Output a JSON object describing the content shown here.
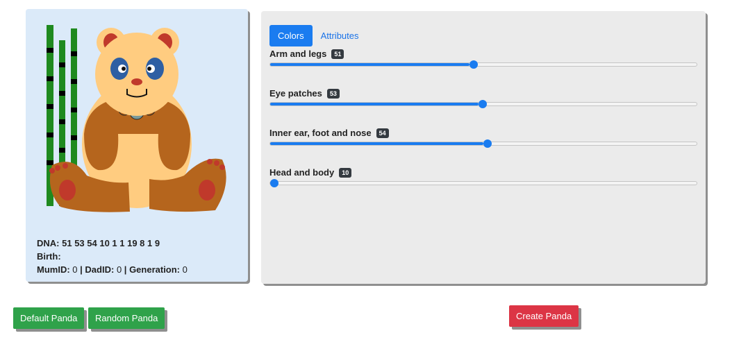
{
  "colors": {
    "accent": "#1a7cf0",
    "card_bg": "#dbeaf9",
    "panel_bg": "#ebebeb",
    "green_button": "#2fa24a",
    "red_button": "#dc3545",
    "panda_body": "#ffcc80",
    "panda_limbs": "#b5651d",
    "panda_eye_patch": "#2e5fa3",
    "panda_ear_foot_nose": "#c0392b",
    "bamboo": "#1f8a1f"
  },
  "panda_card": {
    "dna_label": "DNA:",
    "dna_value": "51 53 54 10 1 1 19 8 1 9",
    "birth_label": "Birth:",
    "birth_value": "",
    "mum_label": "MumID:",
    "mum_value": "0",
    "dad_label": "DadID:",
    "dad_value": "0",
    "generation_label": "Generation:",
    "generation_value": "0",
    "separator": "|"
  },
  "tabs": [
    {
      "label": "Colors",
      "active": true
    },
    {
      "label": "Attributes",
      "active": false
    }
  ],
  "sliders": [
    {
      "label": "Arm and legs",
      "value": "51",
      "fraction": 0.467
    },
    {
      "label": "Eye patches",
      "value": "53",
      "fraction": 0.489
    },
    {
      "label": "Inner ear, foot and nose",
      "value": "54",
      "fraction": 0.5
    },
    {
      "label": "Head and body",
      "value": "10",
      "fraction": 0.0
    }
  ],
  "buttons": {
    "default_panda": "Default Panda",
    "random_panda": "Random Panda",
    "create_panda": "Create Panda"
  },
  "icons": {
    "panda_illustration": "panda-illustration",
    "bamboo": "bamboo-icon"
  }
}
